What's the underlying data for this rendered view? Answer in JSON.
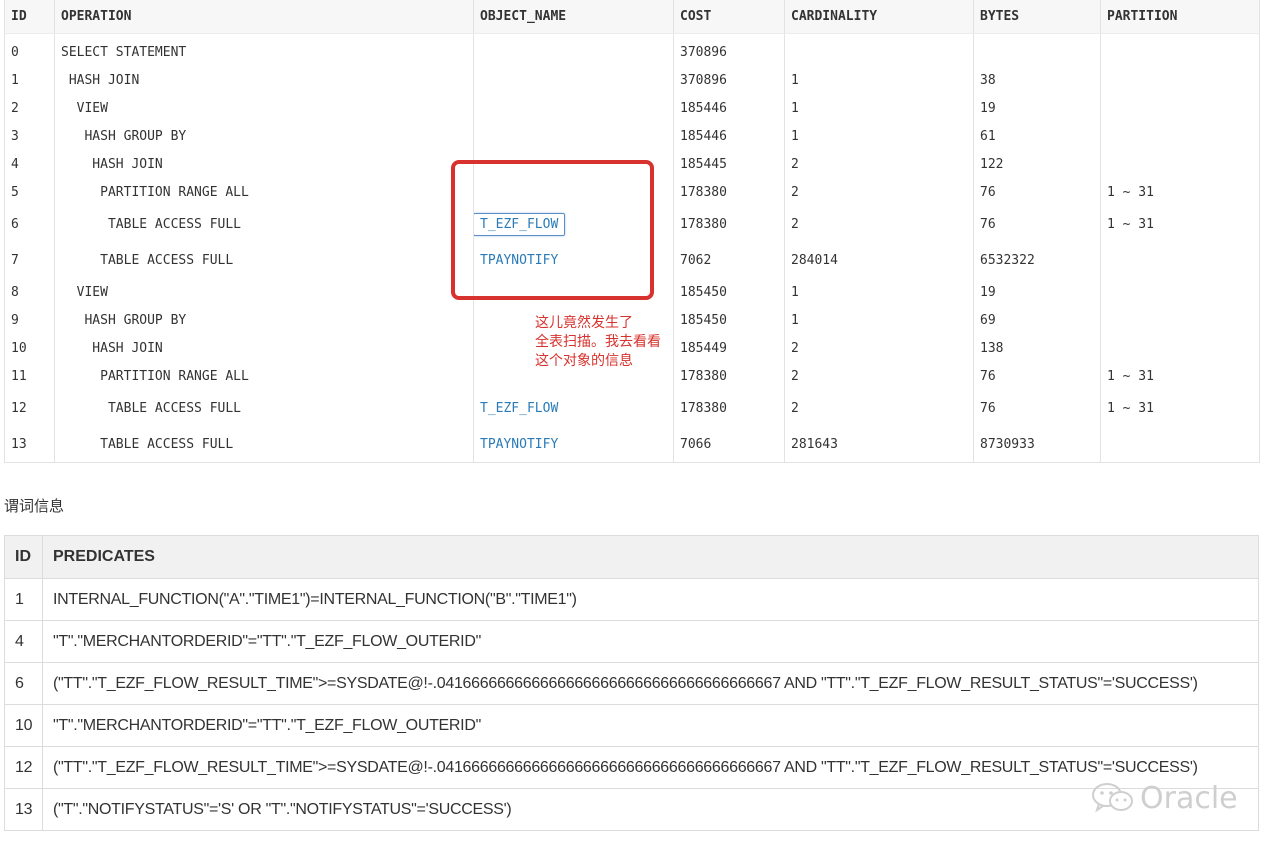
{
  "plan": {
    "columns": [
      "ID",
      "OPERATION",
      "OBJECT_NAME",
      "COST",
      "CARDINALITY",
      "BYTES",
      "PARTITION"
    ],
    "rows": [
      {
        "id": "0",
        "operation": "SELECT STATEMENT",
        "object": "",
        "cost": "370896",
        "card": "",
        "bytes": "",
        "partition": ""
      },
      {
        "id": "1",
        "operation": " HASH JOIN",
        "object": "",
        "cost": "370896",
        "card": "1",
        "bytes": "38",
        "partition": ""
      },
      {
        "id": "2",
        "operation": "  VIEW",
        "object": "",
        "cost": "185446",
        "card": "1",
        "bytes": "19",
        "partition": ""
      },
      {
        "id": "3",
        "operation": "   HASH GROUP BY",
        "object": "",
        "cost": "185446",
        "card": "1",
        "bytes": "61",
        "partition": ""
      },
      {
        "id": "4",
        "operation": "    HASH JOIN",
        "object": "",
        "cost": "185445",
        "card": "2",
        "bytes": "122",
        "partition": ""
      },
      {
        "id": "5",
        "operation": "     PARTITION RANGE ALL",
        "object": "",
        "cost": "178380",
        "card": "2",
        "bytes": "76",
        "partition": "1 ~ 31"
      },
      {
        "id": "6",
        "operation": "      TABLE ACCESS FULL",
        "object": "T_EZF_FLOW",
        "cost": "178380",
        "card": "2",
        "bytes": "76",
        "partition": "1 ~ 31"
      },
      {
        "id": "7",
        "operation": "     TABLE ACCESS FULL",
        "object": "TPAYNOTIFY",
        "cost": "7062",
        "card": "284014",
        "bytes": "6532322",
        "partition": ""
      },
      {
        "id": "8",
        "operation": "  VIEW",
        "object": "",
        "cost": "185450",
        "card": "1",
        "bytes": "19",
        "partition": ""
      },
      {
        "id": "9",
        "operation": "   HASH GROUP BY",
        "object": "",
        "cost": "185450",
        "card": "1",
        "bytes": "69",
        "partition": ""
      },
      {
        "id": "10",
        "operation": "    HASH JOIN",
        "object": "",
        "cost": "185449",
        "card": "2",
        "bytes": "138",
        "partition": ""
      },
      {
        "id": "11",
        "operation": "     PARTITION RANGE ALL",
        "object": "",
        "cost": "178380",
        "card": "2",
        "bytes": "76",
        "partition": "1 ~ 31"
      },
      {
        "id": "12",
        "operation": "      TABLE ACCESS FULL",
        "object": "T_EZF_FLOW",
        "cost": "178380",
        "card": "2",
        "bytes": "76",
        "partition": "1 ~ 31"
      },
      {
        "id": "13",
        "operation": "     TABLE ACCESS FULL",
        "object": "TPAYNOTIFY",
        "cost": "7066",
        "card": "281643",
        "bytes": "8730933",
        "partition": ""
      }
    ]
  },
  "annotation": {
    "lines": [
      "这儿竟然发生了",
      "全表扫描。我去看看",
      "这个对象的信息"
    ],
    "color": "#d7322d"
  },
  "section_title": "谓词信息",
  "predicates": {
    "columns": [
      "ID",
      "PREDICATES"
    ],
    "rows": [
      {
        "id": "1",
        "text": "INTERNAL_FUNCTION(\"A\".\"TIME1\")=INTERNAL_FUNCTION(\"B\".\"TIME1\")"
      },
      {
        "id": "4",
        "text": "\"T\".\"MERCHANTORDERID\"=\"TT\".\"T_EZF_FLOW_OUTERID\""
      },
      {
        "id": "6",
        "text": "(\"TT\".\"T_EZF_FLOW_RESULT_TIME\">=SYSDATE@!-.0416666666666666666666666666666666666667 AND \"TT\".\"T_EZF_FLOW_RESULT_STATUS\"='SUCCESS')"
      },
      {
        "id": "10",
        "text": "\"T\".\"MERCHANTORDERID\"=\"TT\".\"T_EZF_FLOW_OUTERID\""
      },
      {
        "id": "12",
        "text": "(\"TT\".\"T_EZF_FLOW_RESULT_TIME\">=SYSDATE@!-.0416666666666666666666666666666666666667 AND \"TT\".\"T_EZF_FLOW_RESULT_STATUS\"='SUCCESS')"
      },
      {
        "id": "13",
        "text": "(\"T\".\"NOTIFYSTATUS\"='S' OR \"T\".\"NOTIFYSTATUS\"='SUCCESS')"
      }
    ]
  },
  "watermark": {
    "text": "Oracle",
    "icon": "wechat-icon"
  }
}
